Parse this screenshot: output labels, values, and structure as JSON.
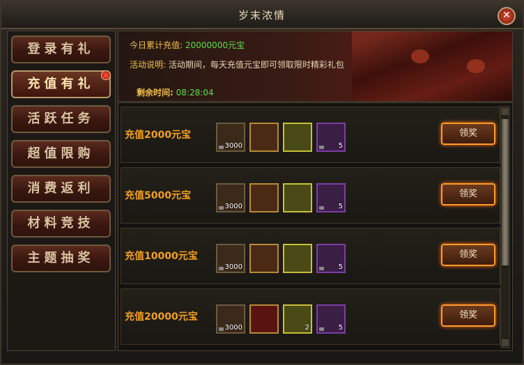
{
  "window": {
    "title": "岁末浓情",
    "close_icon": "close-icon"
  },
  "sidebar": {
    "items": [
      {
        "label": "登录有礼",
        "active": false
      },
      {
        "label": "充值有礼",
        "active": true,
        "badge": true
      },
      {
        "label": "活跃任务",
        "active": false
      },
      {
        "label": "超值限购",
        "active": false
      },
      {
        "label": "消费返利",
        "active": false
      },
      {
        "label": "材料竞技",
        "active": false
      },
      {
        "label": "主题抽奖",
        "active": false
      }
    ]
  },
  "header": {
    "total_label": "今日累计充值:",
    "total_value": "20000000元宝",
    "desc_label": "活动说明:",
    "desc_text": "活动期间，每天充值元宝即可领取限时精彩礼包",
    "time_label": "剩余时间:",
    "time_value": "08:28:04"
  },
  "rewards": [
    {
      "label": "充值2000元宝",
      "button": "领奖",
      "items": [
        {
          "icon": "gold-ingot-icon",
          "count": "3000",
          "style": "d"
        },
        {
          "icon": "scroll-icon",
          "count": "",
          "style": "r"
        },
        {
          "icon": "red-pouch-icon",
          "count": "",
          "style": "y"
        },
        {
          "icon": "token-bag-icon",
          "count": "5",
          "style": "p"
        }
      ]
    },
    {
      "label": "充值5000元宝",
      "button": "领奖",
      "items": [
        {
          "icon": "gold-ingot-icon",
          "count": "3000",
          "style": "d"
        },
        {
          "icon": "scroll-icon",
          "count": "",
          "style": "r"
        },
        {
          "icon": "red-pouch-icon",
          "count": "",
          "style": "y"
        },
        {
          "icon": "token-bag-icon",
          "count": "5",
          "style": "p"
        }
      ]
    },
    {
      "label": "充值10000元宝",
      "button": "领奖",
      "items": [
        {
          "icon": "gold-ingot-icon",
          "count": "3000",
          "style": "d"
        },
        {
          "icon": "scroll-icon",
          "count": "",
          "style": "r"
        },
        {
          "icon": "red-pouch-icon",
          "count": "",
          "style": "y"
        },
        {
          "icon": "token-bag-icon",
          "count": "5",
          "style": "p"
        }
      ]
    },
    {
      "label": "充值20000元宝",
      "button": "领奖",
      "items": [
        {
          "icon": "gold-ingot-icon",
          "count": "3000",
          "style": "d"
        },
        {
          "icon": "red-scroll-icon",
          "count": "",
          "style": "r"
        },
        {
          "icon": "red-pouch-icon",
          "count": "2",
          "style": "y"
        },
        {
          "icon": "token-bag-icon",
          "count": "5",
          "style": "p"
        }
      ]
    }
  ]
}
